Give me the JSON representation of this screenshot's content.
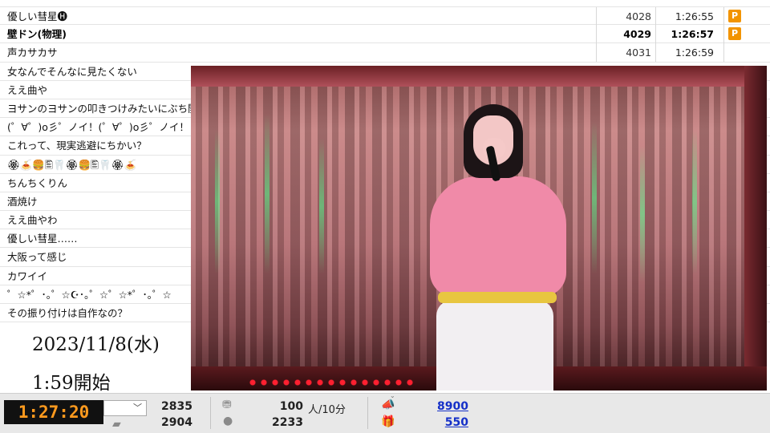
{
  "comments": [
    {
      "text": "優しい彗星🅗",
      "no": "4028",
      "time": "1:26:55",
      "premium": "P",
      "bold": false
    },
    {
      "text": "壁ドン(物理)",
      "no": "4029",
      "time": "1:26:57",
      "premium": "P",
      "bold": true
    },
    {
      "text": "声カサカサ",
      "no": "4031",
      "time": "1:26:59",
      "premium": "",
      "bold": false
    },
    {
      "text": "女なんでそんなに見たくない"
    },
    {
      "text": "ええ曲や"
    },
    {
      "text": "ヨサンのヨサンの叩きつけみたいにぶち開け"
    },
    {
      "text": "(゜∀゜)o彡゜ノイ！(゜∀゜)o彡゜ノイ！"
    },
    {
      "text": "これって、現実逃避にちかい？"
    },
    {
      "text": "🏵🍝🍔🖺🦷🏵🍔🖺🦷🏵🍝"
    },
    {
      "text": "ちんちくりん"
    },
    {
      "text": "酒焼け"
    },
    {
      "text": "ええ曲やわ"
    },
    {
      "text": "優しい彗星……"
    },
    {
      "text": "大阪って感じ"
    },
    {
      "text": "カワイイ"
    },
    {
      "text": "゜☆*゜･｡゜☆☪･｡゜☆゜☆*゜･｡゜☆"
    },
    {
      "text": "その振り付けは自作なの？"
    }
  ],
  "overlay": {
    "date": "2023/11/8(水)",
    "start": "1:59開始"
  },
  "bar": {
    "clock": "1:27:20",
    "dropdown_arrow": "﹀",
    "count_a": "2835",
    "count_b": "2904",
    "viewers": "100",
    "viewers_unit": "人/10分",
    "members": "2233",
    "ad_points": "8900",
    "gift_points": "550"
  },
  "colors": {
    "clock_text": "#ff9a1e",
    "premium_badge": "#f29400",
    "link": "#1530c8"
  },
  "icons": {
    "clock": "clock-icon",
    "comment": "comment-icon",
    "visitor": "visitor-icon",
    "member": "member-icon",
    "ad": "megaphone-icon",
    "gift": "gift-icon"
  }
}
